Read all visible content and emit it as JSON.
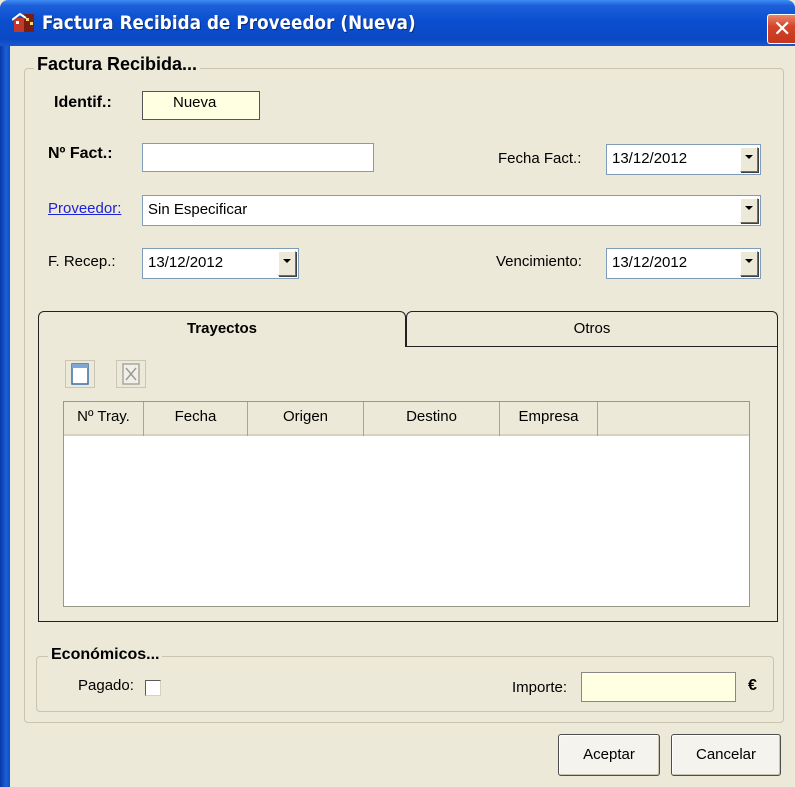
{
  "window": {
    "title": "Factura Recibida de Proveedor (Nueva)",
    "close_glyph": "✕"
  },
  "factura": {
    "group_title": "Factura Recibida...",
    "identif_label": "Identif.:",
    "identif_value": "Nueva",
    "nfact_label": "Nº Fact.:",
    "nfact_value": "",
    "fecha_fact_label": "Fecha Fact.:",
    "fecha_fact_value": "13/12/2012",
    "proveedor_label": "Proveedor:",
    "proveedor_value": "Sin Especificar",
    "recep_label": "F. Recep.:",
    "recep_value": "13/12/2012",
    "vencimiento_label": "Vencimiento:",
    "vencimiento_value": "13/12/2012"
  },
  "tabs": [
    {
      "label": "Trayectos",
      "active": true
    },
    {
      "label": "Otros",
      "active": false
    }
  ],
  "toolbar": {
    "new_icon": "new-document-icon",
    "delete_icon": "delete-icon"
  },
  "grid": {
    "columns": [
      "Nº Tray.",
      "Fecha",
      "Origen",
      "Destino",
      "Empresa",
      ""
    ],
    "rows": []
  },
  "economicos": {
    "group_title": "Económicos...",
    "pagado_label": "Pagado:",
    "pagado_checked": false,
    "importe_label": "Importe:",
    "importe_value": "",
    "currency": "€"
  },
  "buttons": {
    "aceptar": "Aceptar",
    "cancelar": "Cancelar"
  },
  "colors": {
    "titlebar": "#0a4fd0",
    "window_bg": "#ece9d8",
    "yellow_field": "#ffffe1",
    "link": "#1e23d6",
    "close_button": "#d6452a"
  }
}
